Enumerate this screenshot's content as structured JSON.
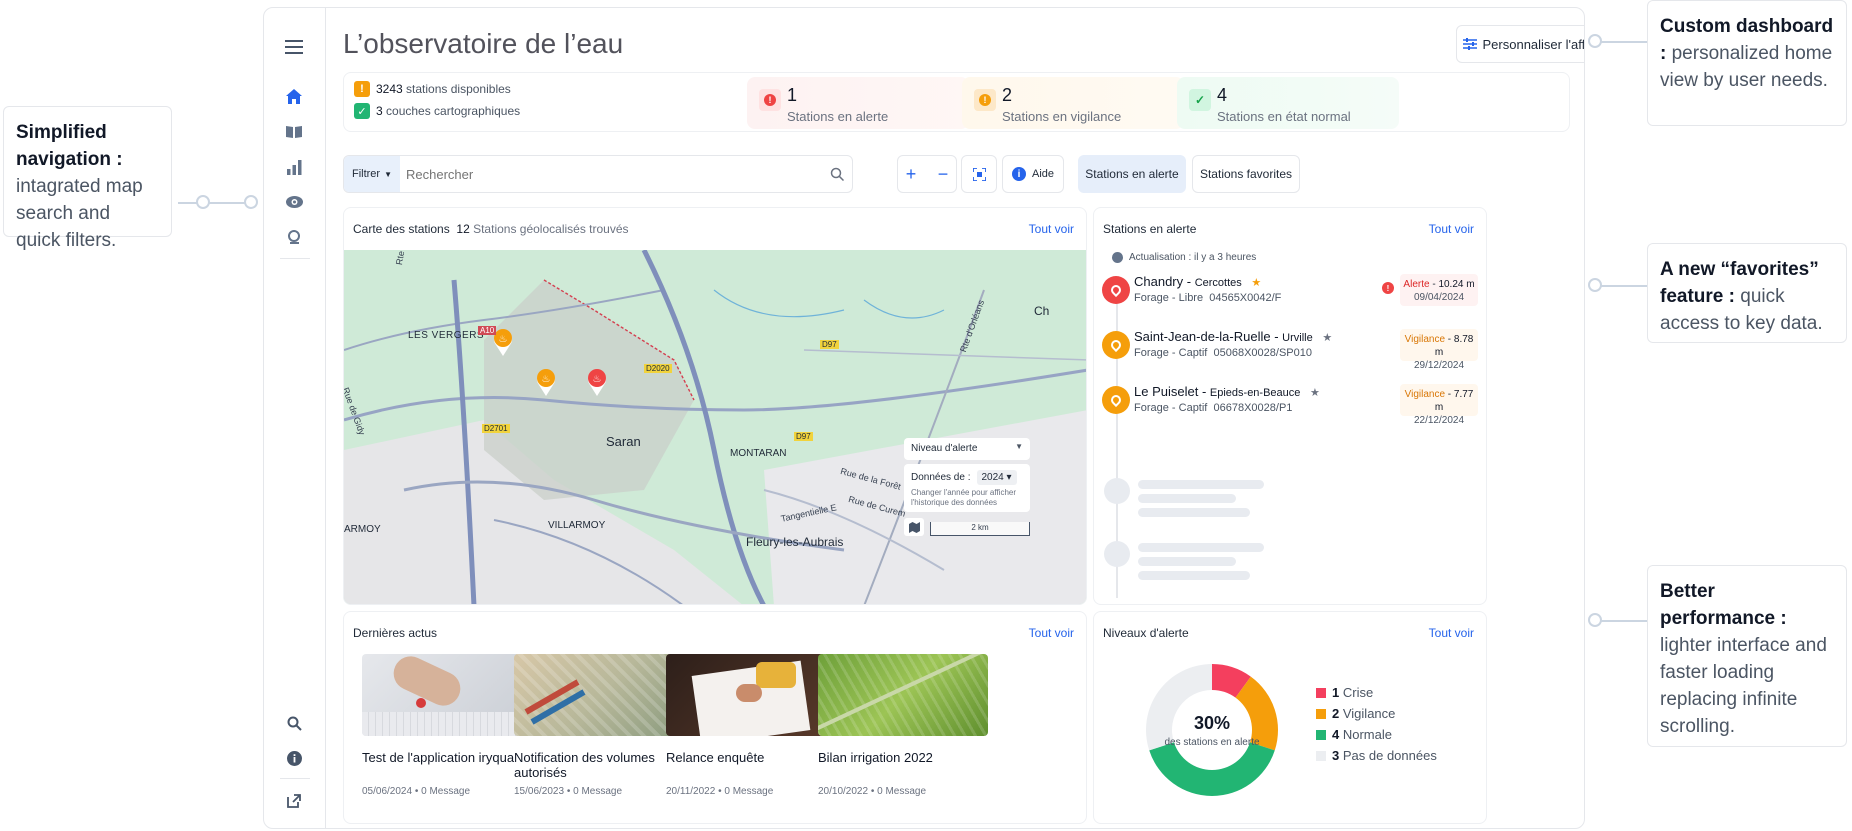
{
  "annotations": {
    "nav": {
      "title": "Simplified navigation :",
      "text": "intagrated map search and quick filters."
    },
    "dashboard": {
      "title": "Custom dashboard :",
      "text": "personalized home view by user needs."
    },
    "favorites": {
      "title": "A new “favorites” feature :",
      "text": "quick access to key data."
    },
    "performance": {
      "title": "Better performance :",
      "text": "lighter interface and faster loading replacing infinite scrolling."
    }
  },
  "app": {
    "title": "L’observatoire de l’eau",
    "customize_label": "Personnaliser l'affichage",
    "summary": {
      "stations_count": "3243",
      "stations_label": "stations disponibles",
      "layers_count": "3",
      "layers_label": "couches cartographiques"
    },
    "stats": [
      {
        "value": "1",
        "label": "Stations en alerte",
        "color": "#ef4444"
      },
      {
        "value": "2",
        "label": "Stations en vigilance",
        "color": "#f59e0b"
      },
      {
        "value": "4",
        "label": "Stations en état normal",
        "color": "#22c55e"
      }
    ],
    "filter_label": "Filtrer",
    "search_placeholder": "Rechercher",
    "help_label": "Aide",
    "tabs": [
      "Stations en alerte",
      "Stations favorites"
    ]
  },
  "map_card": {
    "title": "Carte des stations",
    "count": "12",
    "count_label": "Stations géolocalisés trouvés",
    "see_all": "Tout voir",
    "labels": {
      "les_vergers": "LES VERGERS",
      "saran": "Saran",
      "montaran": "MONTARAN",
      "villarmoy": "VILLARMOY",
      "armoy": "ARMOY",
      "fleury": "Fleury-les-Aubrais",
      "ch": "Ch",
      "a10": "A10",
      "d2020": "D2020",
      "d97a": "D97",
      "d97b": "D97",
      "d2701": "D2701",
      "rte_orl1": "Rte d'Orl",
      "rte_orl2": "Rte d'Orléans",
      "rue_gidy": "Rue de Gidy",
      "rue_foret": "Rue de la Forêt",
      "rue_curem": "Rue de Curem",
      "tangentielle": "Tangentielle E"
    },
    "alert_level_select": "Niveau d'alerte",
    "data_of_label": "Données de :",
    "year": "2024",
    "year_hint": "Changer l'année pour afficher l'historique des données",
    "scale": "2 km"
  },
  "alerts_card": {
    "title": "Stations en alerte",
    "see_all": "Tout voir",
    "updated": "Actualisation : il y a 3 heures",
    "rows": [
      {
        "name": "Chandry",
        "place": "Cercottes",
        "type": "Forage - Libre",
        "code": "04565X0042/F",
        "level": "Alerte",
        "depth": "10.24 m",
        "date": "09/04/2024",
        "color": "#ef4444",
        "tagbg": "#fef2f2",
        "tagcolor": "#dc2626",
        "star": "#f59e0b"
      },
      {
        "name": "Saint-Jean-de-la-Ruelle",
        "place": "Urville",
        "type": "Forage - Captif",
        "code": "05068X0028/SP010",
        "level": "Vigilance",
        "depth": "8.78 m",
        "date": "29/12/2024",
        "color": "#f59e0b",
        "tagbg": "#fff7ed",
        "tagcolor": "#d97706",
        "star": "#6b7280"
      },
      {
        "name": "Le Puiselet",
        "place": "Epieds-en-Beauce",
        "type": "Forage - Captif",
        "code": "06678X0028/P1",
        "level": "Vigilance",
        "depth": "7.77 m",
        "date": "22/12/2024",
        "color": "#f59e0b",
        "tagbg": "#fff7ed",
        "tagcolor": "#d97706",
        "star": "#6b7280"
      }
    ]
  },
  "news_card": {
    "title": "Dernières actus",
    "see_all": "Tout voir",
    "items": [
      {
        "title": "Test de l'application iryqua",
        "meta": "05/06/2024 • 0 Message"
      },
      {
        "title": "Notification des volumes autorisés",
        "meta": "15/06/2023 • 0 Message"
      },
      {
        "title": "Relance enquête",
        "meta": "20/11/2022 • 0 Message"
      },
      {
        "title": "Bilan irrigation 2022",
        "meta": "20/10/2022 • 0 Message"
      }
    ]
  },
  "levels_card": {
    "title": "Niveaux d'alerte",
    "see_all": "Tout voir",
    "center_value": "30%",
    "center_label": "des stations en alerte",
    "legend": [
      {
        "count": "1",
        "label": "Crise",
        "color": "#f43f5e"
      },
      {
        "count": "2",
        "label": "Vigilance",
        "color": "#f59e0b"
      },
      {
        "count": "4",
        "label": "Normale",
        "color": "#22b573"
      },
      {
        "count": "3",
        "label": "Pas de données",
        "color": "#eceef1"
      }
    ]
  },
  "chart_data": {
    "type": "pie",
    "categories": [
      "Crise",
      "Vigilance",
      "Normale",
      "Pas de données"
    ],
    "values": [
      1,
      2,
      4,
      3
    ],
    "colors": [
      "#f43f5e",
      "#f59e0b",
      "#22b573",
      "#eceef1"
    ],
    "title": "Niveaux d'alerte"
  }
}
